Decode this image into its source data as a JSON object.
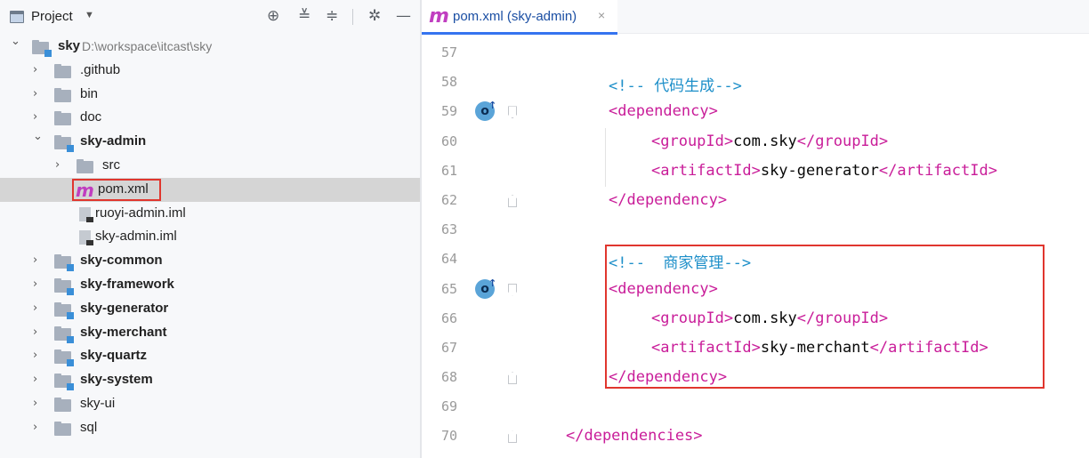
{
  "project_panel": {
    "title": "Project",
    "caret": "▼",
    "tools": [
      "locate-icon",
      "expand-all-icon",
      "collapse-all-icon",
      "gear-icon",
      "hide-icon"
    ],
    "tree": [
      {
        "label": "sky",
        "path": "D:\\workspace\\itcast\\sky",
        "bold": true,
        "expanded": true,
        "level": 0,
        "kind": "module"
      },
      {
        "label": ".github",
        "bold": false,
        "expanded": false,
        "level": 1,
        "kind": "folder"
      },
      {
        "label": "bin",
        "bold": false,
        "expanded": false,
        "level": 1,
        "kind": "folder"
      },
      {
        "label": "doc",
        "bold": false,
        "expanded": false,
        "level": 1,
        "kind": "folder"
      },
      {
        "label": "sky-admin",
        "bold": true,
        "expanded": true,
        "level": 1,
        "kind": "module"
      },
      {
        "label": "src",
        "bold": false,
        "expanded": false,
        "level": 2,
        "kind": "folder"
      },
      {
        "label": "pom.xml",
        "bold": false,
        "level": 2,
        "kind": "maven",
        "selected": true
      },
      {
        "label": "ruoyi-admin.iml",
        "bold": false,
        "level": 2,
        "kind": "file"
      },
      {
        "label": "sky-admin.iml",
        "bold": false,
        "level": 2,
        "kind": "file"
      },
      {
        "label": "sky-common",
        "bold": true,
        "expanded": false,
        "level": 1,
        "kind": "module"
      },
      {
        "label": "sky-framework",
        "bold": true,
        "expanded": false,
        "level": 1,
        "kind": "module"
      },
      {
        "label": "sky-generator",
        "bold": true,
        "expanded": false,
        "level": 1,
        "kind": "module"
      },
      {
        "label": "sky-merchant",
        "bold": true,
        "expanded": false,
        "level": 1,
        "kind": "module"
      },
      {
        "label": "sky-quartz",
        "bold": true,
        "expanded": false,
        "level": 1,
        "kind": "module"
      },
      {
        "label": "sky-system",
        "bold": true,
        "expanded": false,
        "level": 1,
        "kind": "module"
      },
      {
        "label": "sky-ui",
        "bold": false,
        "expanded": false,
        "level": 1,
        "kind": "folder"
      },
      {
        "label": "sql",
        "bold": false,
        "expanded": false,
        "level": 1,
        "kind": "folder"
      }
    ]
  },
  "editor": {
    "tab": {
      "icon": "m",
      "label": "pom.xml (sky-admin)",
      "close": "×"
    },
    "lines": [
      {
        "num": "57",
        "indent": 0,
        "parts": []
      },
      {
        "num": "58",
        "indent": 2,
        "parts": [
          {
            "t": "<!-- ",
            "c": "comment"
          },
          {
            "t": "代码生成",
            "c": "comment cjk"
          },
          {
            "t": "-->",
            "c": "comment"
          }
        ]
      },
      {
        "num": "59",
        "indent": 2,
        "badge": true,
        "fold": "open",
        "parts": [
          {
            "t": "<dependency>",
            "c": "tag"
          }
        ]
      },
      {
        "num": "60",
        "indent": 3,
        "parts": [
          {
            "t": "<groupId>",
            "c": "tag"
          },
          {
            "t": "com.sky",
            "c": "txt"
          },
          {
            "t": "</groupId>",
            "c": "tag"
          }
        ]
      },
      {
        "num": "61",
        "indent": 3,
        "parts": [
          {
            "t": "<artifactId>",
            "c": "tag"
          },
          {
            "t": "sky-generator",
            "c": "txt"
          },
          {
            "t": "</artifactId>",
            "c": "tag"
          }
        ]
      },
      {
        "num": "62",
        "indent": 2,
        "fold": "close",
        "parts": [
          {
            "t": "</dependency>",
            "c": "tag"
          }
        ]
      },
      {
        "num": "63",
        "indent": 0,
        "parts": []
      },
      {
        "num": "64",
        "indent": 2,
        "parts": [
          {
            "t": "<!--  ",
            "c": "comment"
          },
          {
            "t": "商家管理",
            "c": "comment cjk"
          },
          {
            "t": "-->",
            "c": "comment"
          }
        ]
      },
      {
        "num": "65",
        "indent": 2,
        "badge": true,
        "fold": "open",
        "parts": [
          {
            "t": "<dependency>",
            "c": "tag"
          }
        ]
      },
      {
        "num": "66",
        "indent": 3,
        "parts": [
          {
            "t": "<groupId>",
            "c": "tag"
          },
          {
            "t": "com.sky",
            "c": "txt"
          },
          {
            "t": "</groupId>",
            "c": "tag"
          }
        ]
      },
      {
        "num": "67",
        "indent": 3,
        "parts": [
          {
            "t": "<artifactId>",
            "c": "tag"
          },
          {
            "t": "sky-merchant",
            "c": "txt"
          },
          {
            "t": "</artifactId>",
            "c": "tag"
          }
        ]
      },
      {
        "num": "68",
        "indent": 2,
        "fold": "close",
        "parts": [
          {
            "t": "</dependency>",
            "c": "tag"
          }
        ]
      },
      {
        "num": "69",
        "indent": 0,
        "parts": []
      },
      {
        "num": "70",
        "indent": 1,
        "fold": "close",
        "parts": [
          {
            "t": "</dependencies>",
            "c": "tag"
          }
        ]
      }
    ],
    "badge_text": "o",
    "badge_arrow": "↑"
  },
  "colors": {
    "tag": "#c91d99",
    "comment": "#1d8fc9",
    "highlight": "#e0362e",
    "accent": "#3574f0"
  }
}
